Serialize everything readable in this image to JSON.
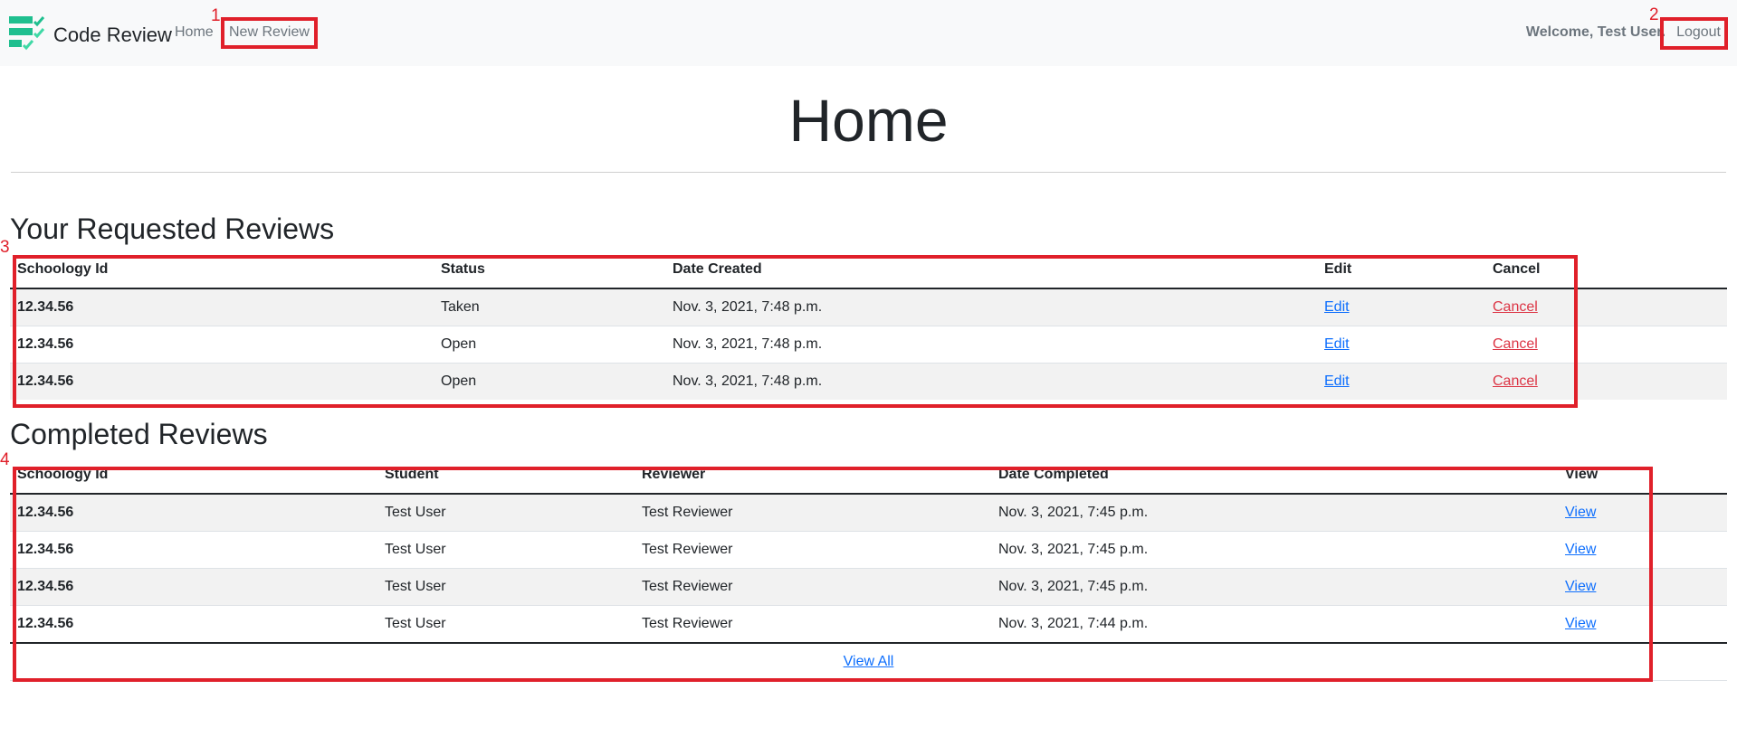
{
  "navbar": {
    "brand": "Code Review",
    "links": [
      {
        "label": "Home"
      },
      {
        "label": "New Review"
      }
    ],
    "welcome": "Welcome, Test User.",
    "logout": "Logout"
  },
  "page_title": "Home",
  "requested": {
    "title": "Your Requested Reviews",
    "headers": [
      "Schoology Id",
      "Status",
      "Date Created",
      "Edit",
      "Cancel"
    ],
    "rows": [
      {
        "id": "12.34.56",
        "status": "Taken",
        "date": "Nov. 3, 2021, 7:48 p.m.",
        "edit": "Edit",
        "cancel": "Cancel"
      },
      {
        "id": "12.34.56",
        "status": "Open",
        "date": "Nov. 3, 2021, 7:48 p.m.",
        "edit": "Edit",
        "cancel": "Cancel"
      },
      {
        "id": "12.34.56",
        "status": "Open",
        "date": "Nov. 3, 2021, 7:48 p.m.",
        "edit": "Edit",
        "cancel": "Cancel"
      }
    ]
  },
  "completed": {
    "title": "Completed Reviews",
    "headers": [
      "Schoology Id",
      "Student",
      "Reviewer",
      "Date Completed",
      "View"
    ],
    "rows": [
      {
        "id": "12.34.56",
        "student": "Test User",
        "reviewer": "Test Reviewer",
        "date": "Nov. 3, 2021, 7:45 p.m.",
        "view": "View"
      },
      {
        "id": "12.34.56",
        "student": "Test User",
        "reviewer": "Test Reviewer",
        "date": "Nov. 3, 2021, 7:45 p.m.",
        "view": "View"
      },
      {
        "id": "12.34.56",
        "student": "Test User",
        "reviewer": "Test Reviewer",
        "date": "Nov. 3, 2021, 7:45 p.m.",
        "view": "View"
      },
      {
        "id": "12.34.56",
        "student": "Test User",
        "reviewer": "Test Reviewer",
        "date": "Nov. 3, 2021, 7:44 p.m.",
        "view": "View"
      }
    ],
    "view_all": "View All"
  },
  "annotations": [
    "1",
    "2",
    "3",
    "4"
  ],
  "colors": {
    "annotation": "#e0202a",
    "link": "#0d6efd",
    "danger": "#dc3545",
    "logo_green": "#1fbf8f",
    "logo_green_light": "#3fd9a5"
  },
  "icons": {
    "brand": "checklist-logo-icon"
  }
}
